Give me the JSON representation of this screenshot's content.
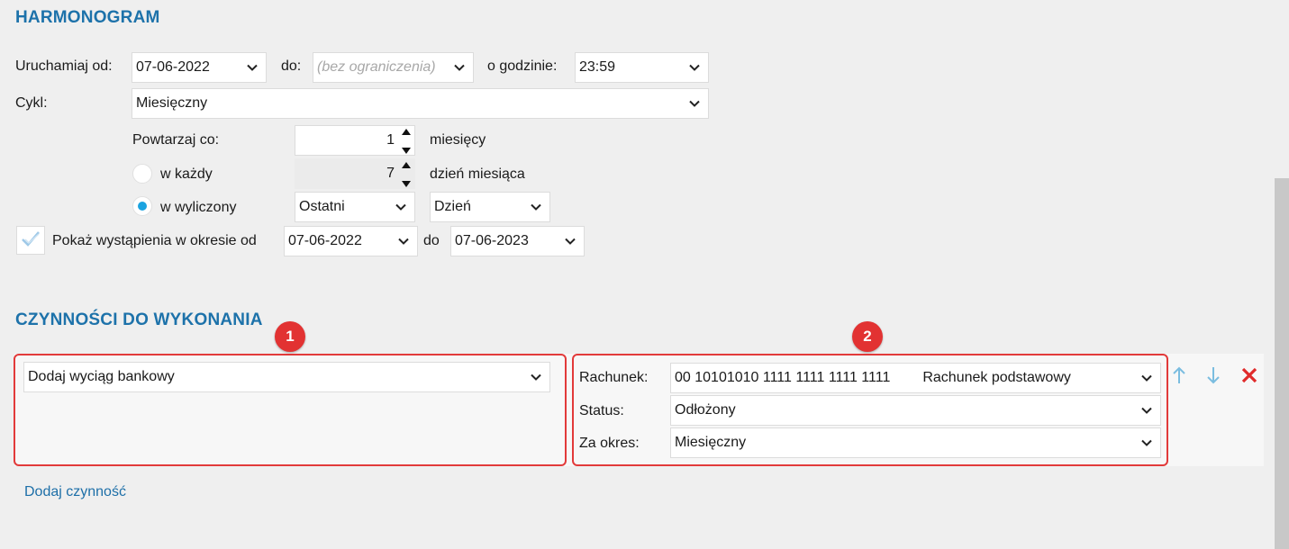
{
  "schedule": {
    "title": "HARMONOGRAM",
    "run_from_label": "Uruchamiaj od:",
    "run_from_value": "07-06-2022",
    "to_label": "do:",
    "to_placeholder": "(bez ograniczenia)",
    "at_time_label": "o godzinie:",
    "time_value": "23:59",
    "cycle_label": "Cykl:",
    "cycle_value": "Miesięczny",
    "repeat_label": "Powtarzaj co:",
    "repeat_value": "1",
    "repeat_unit": "miesięcy",
    "every_label": "w każdy",
    "every_value": "7",
    "every_unit": "dzień miesiąca",
    "computed_label": "w wyliczony",
    "computed_which": "Ostatni",
    "computed_kind": "Dzień",
    "show_occurrences_label": "Pokaż wystąpienia w okresie od",
    "show_from": "07-06-2022",
    "show_to_label": "do",
    "show_to": "07-06-2023"
  },
  "actions": {
    "title": "CZYNNOŚCI DO WYKONANIA",
    "action_value": "Dodaj wyciąg bankowy",
    "account_label": "Rachunek:",
    "account_number": "00 10101010 1111 1111 1111 1111",
    "account_name": "Rachunek podstawowy",
    "status_label": "Status:",
    "status_value": "Odłożony",
    "period_label": "Za okres:",
    "period_value": "Miesięczny",
    "add_action_link": "Dodaj czynność"
  },
  "badges": {
    "one": "1",
    "two": "2"
  },
  "colors": {
    "accent": "#1d72aa",
    "highlight": "#e23a3a",
    "radio": "#1aa3e0",
    "up_down_arrows": "#7bbde0",
    "delete": "#e02a2a"
  },
  "icons": [
    "chevron-down-icon",
    "spin-up-icon",
    "spin-down-icon",
    "check-icon",
    "arrow-up-icon",
    "arrow-down-icon",
    "delete-icon"
  ]
}
